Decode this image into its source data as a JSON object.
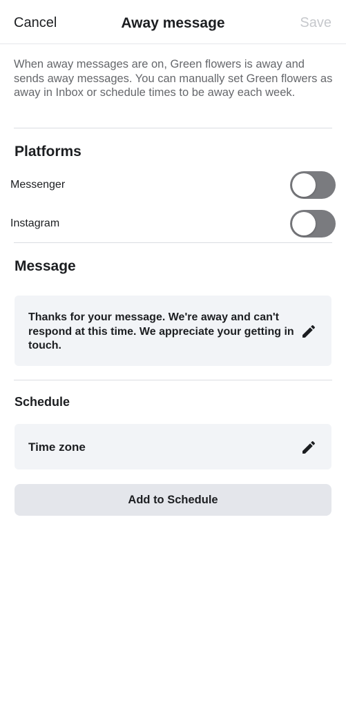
{
  "header": {
    "cancel_label": "Cancel",
    "title": "Away message",
    "save_label": "Save"
  },
  "description": "When away messages are on, Green flowers  is away and sends away messages. You can manually set Green flowers  as away in Inbox or schedule times to be away each week.",
  "platforms": {
    "title": "Platforms",
    "items": [
      {
        "label": "Messenger",
        "enabled": false
      },
      {
        "label": "Instagram",
        "enabled": false
      }
    ]
  },
  "message": {
    "title": "Message",
    "text": "Thanks for your message. We're away and can't respond at this time. We appreciate your getting in touch.",
    "edit_icon": "pencil-icon"
  },
  "schedule": {
    "title": "Schedule",
    "time_zone_label": "Time zone",
    "edit_icon": "pencil-icon",
    "add_button_label": "Add to Schedule"
  },
  "colors": {
    "toggle_off": "#7a7b7f",
    "save_disabled": "#c6c8cc",
    "card_background": "#f2f4f7",
    "button_background": "#e4e6eb",
    "secondary_text": "#65676b"
  }
}
